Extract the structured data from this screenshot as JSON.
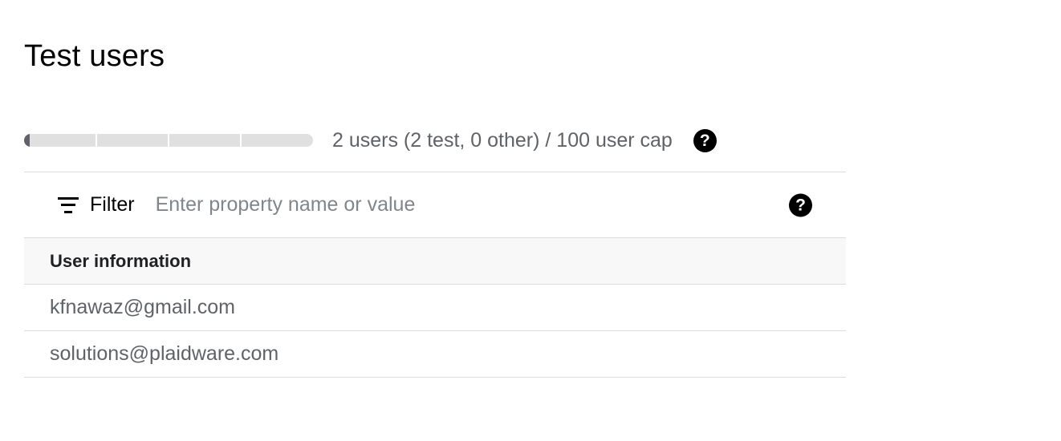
{
  "page": {
    "title": "Test users"
  },
  "usage": {
    "summary": "2 users (2 test, 0 other) / 100 user cap",
    "used_fraction": 0.02,
    "help_icon": "help-circle-icon"
  },
  "filter": {
    "label": "Filter",
    "icon": "filter-list-icon",
    "placeholder": "Enter property name or value",
    "help_icon": "help-circle-icon"
  },
  "table": {
    "columns": [
      "User information"
    ],
    "rows": [
      [
        "kfnawaz@gmail.com"
      ],
      [
        "solutions@plaidware.com"
      ]
    ]
  },
  "colors": {
    "bar_track": "#e0e0e0",
    "bar_fill": "#5f6368",
    "divider": "#dadce0",
    "header_bg": "#f8f8f8"
  }
}
